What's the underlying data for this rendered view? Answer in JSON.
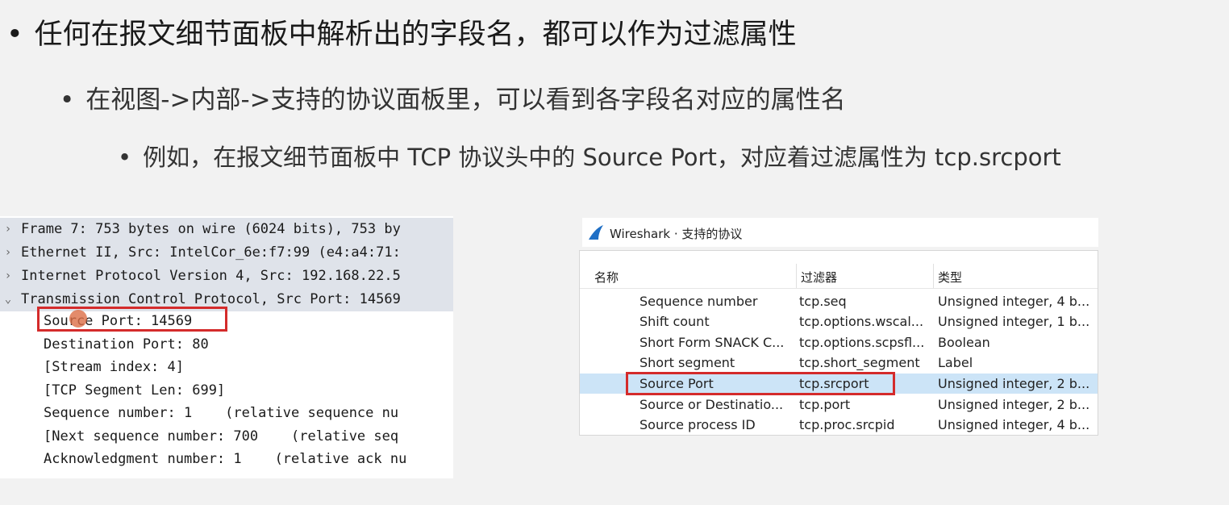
{
  "bullets": {
    "level1": "任何在报文细节面板中解析出的字段名，都可以作为过滤属性",
    "level2": "在视图->内部->支持的协议面板里，可以看到各字段名对应的属性名",
    "level3": "例如，在报文细节面板中 TCP 协议头中的 Source Port，对应着过滤属性为 tcp.srcport"
  },
  "detail_panel": {
    "top_rows": [
      {
        "arrow": "›",
        "text": "Frame 7: 753 bytes on wire (6024 bits), 753 by"
      },
      {
        "arrow": "›",
        "text": "Ethernet II, Src: IntelCor_6e:f7:99 (e4:a4:71:"
      },
      {
        "arrow": "›",
        "text": "Internet Protocol Version 4, Src: 192.168.22.5"
      },
      {
        "arrow": "⌄",
        "text": "Transmission Control Protocol, Src Port: 14569"
      }
    ],
    "child_rows": [
      "Source Port: 14569",
      "Destination Port: 80",
      "[Stream index: 4]",
      "[TCP Segment Len: 699]",
      "Sequence number: 1    (relative sequence nu",
      "[Next sequence number: 700    (relative seq",
      "Acknowledgment number: 1    (relative ack nu"
    ]
  },
  "protocols_window": {
    "title": "Wireshark · 支持的协议",
    "columns": {
      "name": "名称",
      "filter": "过滤器",
      "type": "类型"
    },
    "rows": [
      {
        "name": "Sequence number",
        "filter": "tcp.seq",
        "type": "Unsigned integer, 4 b..."
      },
      {
        "name": "Shift count",
        "filter": "tcp.options.wscal...",
        "type": "Unsigned integer, 1 b..."
      },
      {
        "name": "Short Form SNACK C...",
        "filter": "tcp.options.scpsfl...",
        "type": "Boolean"
      },
      {
        "name": "Short segment",
        "filter": "tcp.short_segment",
        "type": "Label"
      },
      {
        "name": "Source Port",
        "filter": "tcp.srcport",
        "type": "Unsigned integer, 2 b..."
      },
      {
        "name": "Source or Destinatio...",
        "filter": "tcp.port",
        "type": "Unsigned integer, 2 b..."
      },
      {
        "name": "Source process ID",
        "filter": "tcp.proc.srcpid",
        "type": "Unsigned integer, 4 b..."
      }
    ]
  },
  "colors": {
    "highlight_border": "#d42b2b",
    "selected_row": "#cce4f7",
    "wireshark_blue": "#1f6fc5"
  }
}
